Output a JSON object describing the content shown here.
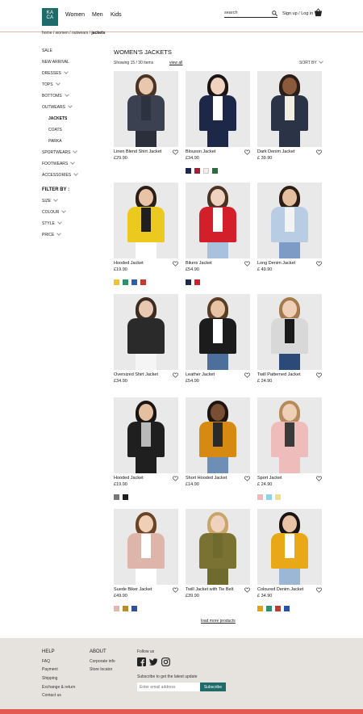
{
  "brand": {
    "line1": "KA",
    "line2": "CA",
    "color": "#1e6b6a"
  },
  "nav": {
    "women": "Women",
    "men": "Men",
    "kids": "Kids"
  },
  "search": {
    "placeholder": "search"
  },
  "account": {
    "signup_login": "Sign up / Log in"
  },
  "breadcrumb": {
    "path": "home / women / outwears / ",
    "current": "jackets"
  },
  "sidebar": {
    "items": [
      {
        "label": "SALE",
        "chevron": false
      },
      {
        "label": "NEW ARRIVAL",
        "chevron": false
      },
      {
        "label": "DRESSES",
        "chevron": true
      },
      {
        "label": "TOPS",
        "chevron": true
      },
      {
        "label": "BOTTOMS",
        "chevron": true
      },
      {
        "label": "OUTWEARS",
        "chevron": true
      },
      {
        "label": "JACKETS",
        "chevron": false,
        "sub": true,
        "active": true
      },
      {
        "label": "COATS",
        "chevron": false,
        "sub": true
      },
      {
        "label": "PARKA",
        "chevron": false,
        "sub": true
      },
      {
        "label": "SPORTWEARS",
        "chevron": true
      },
      {
        "label": "FOOTWEARS",
        "chevron": true
      },
      {
        "label": "ACCESSORIES",
        "chevron": true
      }
    ],
    "filter_title": "FILTER BY :",
    "filters": [
      "SIZE",
      "COLOUR",
      "STYLE",
      "PRICE"
    ]
  },
  "main": {
    "title": "WOMEN'S JACKETS",
    "showing": "Showing 15 / 30 items",
    "view_all": "view all",
    "sort_by": "SORT BY",
    "load_more": "load more products"
  },
  "products": [
    {
      "name": "Linen Blend Shirt Jacket",
      "price": "£29.90",
      "swatches": [],
      "jacket": "#3b4150",
      "inner": "#2d3240",
      "legs": "#2a2f3a",
      "hair": "#4a3322",
      "skin": "#e9c7ae"
    },
    {
      "name": "Blouson Jacket",
      "price": "£34.90",
      "swatches": [
        "#1d2747",
        "#9d2235",
        "#f2efe8",
        "#2d6b3a"
      ],
      "jacket": "#1d2747",
      "inner": "#ffffff",
      "legs": "#1d2747",
      "hair": "#1a1512",
      "skin": "#efd3bf"
    },
    {
      "name": "Dark Denim Jacket",
      "price": "£ 39.90",
      "swatches": [],
      "jacket": "#2a3446",
      "inner": "#f2ede3",
      "legs": "#2a3446",
      "hair": "#2a1e16",
      "skin": "#8b5a3c"
    },
    {
      "name": "Hooded Jacket",
      "price": "£19.90",
      "swatches": [
        "#efc32a",
        "#2f8f6e",
        "#2a5fb0",
        "#c23a2f"
      ],
      "jacket": "#ecc91f",
      "inner": "#1f1f1f",
      "legs": "#ffffff",
      "hair": "#2a1e16",
      "skin": "#e8c3a5"
    },
    {
      "name": "Bikers Jacket",
      "price": "£54.90",
      "swatches": [
        "#1d2747",
        "#d0212a"
      ],
      "jacket": "#d31f2a",
      "inner": "#ffffff",
      "legs": "#a9c1dc",
      "hair": "#4a3322",
      "skin": "#efd3bf"
    },
    {
      "name": "Long Denim Jacket",
      "price": "£ 49.90",
      "swatches": [],
      "jacket": "#b8cde3",
      "inner": "#f3f3f3",
      "legs": "#7d9bc4",
      "hair": "#2a1e16",
      "skin": "#e5c0a0"
    },
    {
      "name": "Oversized Shirt Jacket",
      "price": "£34.90",
      "swatches": [],
      "jacket": "#2a2a2a",
      "inner": "#2a2a2a",
      "legs": "#f5f5f5",
      "hair": "#3a2c20",
      "skin": "#e8c8b0"
    },
    {
      "name": "Leather Jacket",
      "price": "£54.90",
      "swatches": [],
      "jacket": "#1c1c1c",
      "inner": "#ffffff",
      "legs": "#4d6f9c",
      "hair": "#5a3d26",
      "skin": "#e7c2a3"
    },
    {
      "name": "Twill Patterned Jacket",
      "price": "£ 24.90",
      "swatches": [],
      "jacket": "#d8d8d8",
      "inner": "#1a1a1a",
      "legs": "#2b4a78",
      "hair": "#a37a4c",
      "skin": "#efd0b6"
    },
    {
      "name": "Hooded Jacket",
      "price": "£19.90",
      "swatches": [
        "#777777",
        "#1f1f1f"
      ],
      "jacket": "#1f1f1f",
      "inner": "#b9b9b9",
      "legs": "#1f1f1f",
      "hair": "#1a1512",
      "skin": "#e5c0a0"
    },
    {
      "name": "Short Hooded Jacket",
      "price": "£14.90",
      "swatches": [],
      "jacket": "#d68a12",
      "inner": "#2a2a2a",
      "legs": "#6e8fb5",
      "hair": "#1f1410",
      "skin": "#7a4e32"
    },
    {
      "name": "Sport Jacket",
      "price": "£ 24.90",
      "swatches": [
        "#f0b8b8",
        "#8fd4e6",
        "#ece08a"
      ],
      "jacket": "#efbcbc",
      "inner": "#3a3a3a",
      "legs": "#efbcbc",
      "hair": "#b78a5c",
      "skin": "#efd0b6"
    },
    {
      "name": "Suede Biker Jacket",
      "price": "£49.90",
      "swatches": [
        "#e3b7ad",
        "#b88d2b",
        "#2a4fa3"
      ],
      "jacket": "#ddb5aa",
      "inner": "#ffffff",
      "legs": "#ffffff",
      "hair": "#6b4426",
      "skin": "#efd0b6"
    },
    {
      "name": "Twill Jacket with Tie Belt",
      "price": "£39.90",
      "swatches": [],
      "jacket": "#7a7232",
      "inner": "#6f6a2e",
      "legs": "#6f6a2e",
      "hair": "#c9a56a",
      "skin": "#efd3bf"
    },
    {
      "name": "Coloured Denim Jacket",
      "price": "£ 34.90",
      "swatches": [
        "#e5a20f",
        "#2f8f6e",
        "#c23a2f",
        "#2a4fa3"
      ],
      "jacket": "#e8a818",
      "inner": "#ffffff",
      "legs": "#9cb7d6",
      "hair": "#1a1512",
      "skin": "#e8c3a5"
    }
  ],
  "footer": {
    "help_title": "HELP",
    "help_links": [
      "FAQ",
      "Payment",
      "Shipping",
      "Exchange & return",
      "Contact us"
    ],
    "about_title": "ABOUT",
    "about_links": [
      "Corporate info",
      "Store locator"
    ],
    "follow": "Follow us",
    "subscribe_text": "Subscribe to get the latest update",
    "email_placeholder": "Enter email address",
    "subscribe_button": "Subscribe",
    "accent": "#e35a52"
  }
}
